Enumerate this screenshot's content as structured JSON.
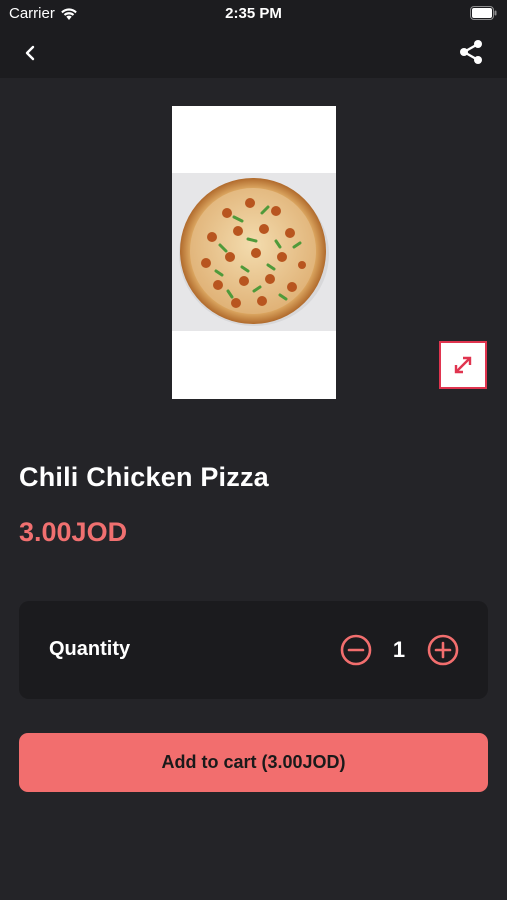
{
  "status_bar": {
    "carrier": "Carrier",
    "time": "2:35 PM",
    "icons": [
      "wifi-icon",
      "battery-icon"
    ]
  },
  "nav": {
    "icons": [
      "chevron-left-icon",
      "share-icon"
    ]
  },
  "product": {
    "name": "Chili Chicken Pizza",
    "price": "3.00JOD",
    "image_subject": "pizza-photo"
  },
  "quantity": {
    "label": "Quantity",
    "value": "1",
    "icons": [
      "minus-circle-icon",
      "plus-circle-icon"
    ]
  },
  "cart": {
    "button_label": "Add to cart (3.00JOD)"
  },
  "colors": {
    "background": "#242428",
    "bar": "#1c1c1f",
    "accent": "#f26e6e",
    "price": "#f07070",
    "expand_border": "#e0344f",
    "card": "#1b1b1e"
  }
}
